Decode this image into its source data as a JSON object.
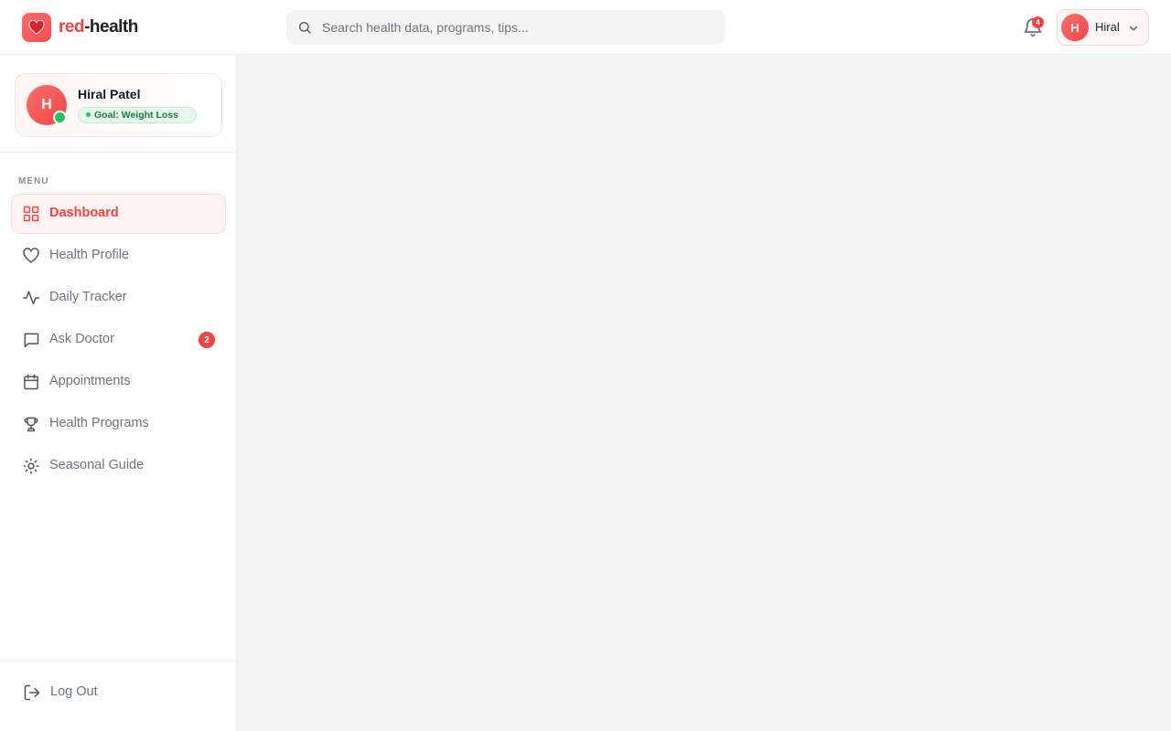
{
  "brand": {
    "name_part1": "red",
    "name_part2": "-health",
    "icon": "heart-icon"
  },
  "search": {
    "placeholder": "Search health data, programs, tips..."
  },
  "notifications": {
    "count": "4"
  },
  "user_menu": {
    "avatar_initial": "H",
    "name": "Hiral"
  },
  "profile": {
    "avatar_initial": "H",
    "name": "Hiral Patel",
    "goal": "Goal: Weight Loss",
    "online": true
  },
  "sidebar": {
    "menu_label": "MENU",
    "items": [
      {
        "label": "Dashboard",
        "icon": "grid-icon",
        "active": true
      },
      {
        "label": "Health Profile",
        "icon": "heart-outline-icon"
      },
      {
        "label": "Daily Tracker",
        "icon": "activity-icon"
      },
      {
        "label": "Ask Doctor",
        "icon": "chat-icon",
        "badge": "2"
      },
      {
        "label": "Appointments",
        "icon": "calendar-icon"
      },
      {
        "label": "Health Programs",
        "icon": "trophy-icon"
      },
      {
        "label": "Seasonal Guide",
        "icon": "sun-icon"
      }
    ],
    "logout_label": "Log Out"
  },
  "colors": {
    "accent": "#ef4444",
    "online": "#22c55e",
    "background": "#f4f4f5"
  }
}
